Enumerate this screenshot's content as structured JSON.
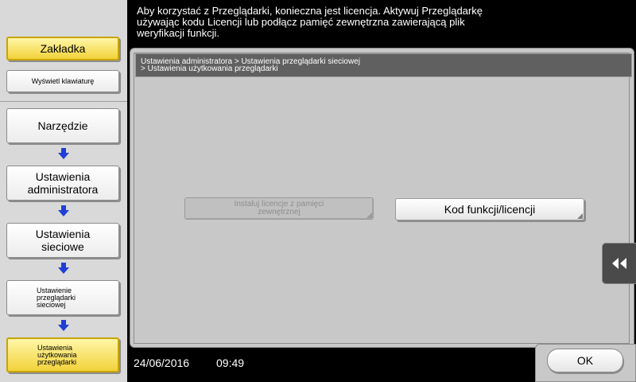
{
  "sidebar": {
    "bookmark_label": "Zakładka",
    "keyboard_label": "Wyświetl klawiaturę",
    "nav": [
      {
        "label": "Narzędzie"
      },
      {
        "label": "Ustawienia administratora"
      },
      {
        "label": "Ustawienia sieciowe"
      },
      {
        "label": "Ustawienie przeglądarki sieciowej"
      },
      {
        "label": "Ustawienia użytkowania przeglądarki"
      }
    ],
    "arrow_icon": "down-arrow-icon",
    "active_color": "#f2d23a"
  },
  "message": "Aby korzystać z Przeglądarki, konieczna jest licencja. Aktywuj Przeglądarkę używając kodu Licencji lub podłącz pamięć zewnętrzna zawierającą plik weryfikacji funkcji.",
  "breadcrumb": {
    "line1": "Ustawienia administratora > Ustawienia przeglądarki sieciowej",
    "line2": "> Ustawienia użytkowania przeglądarki"
  },
  "buttons": {
    "install_license": "Instaluj licencje z pamięci zewnętrznej",
    "function_code": "Kod funkcji/licencji",
    "ok": "OK"
  },
  "collapse_icon": "double-left-arrow-icon",
  "status": {
    "date": "24/06/2016",
    "time": "09:49"
  }
}
